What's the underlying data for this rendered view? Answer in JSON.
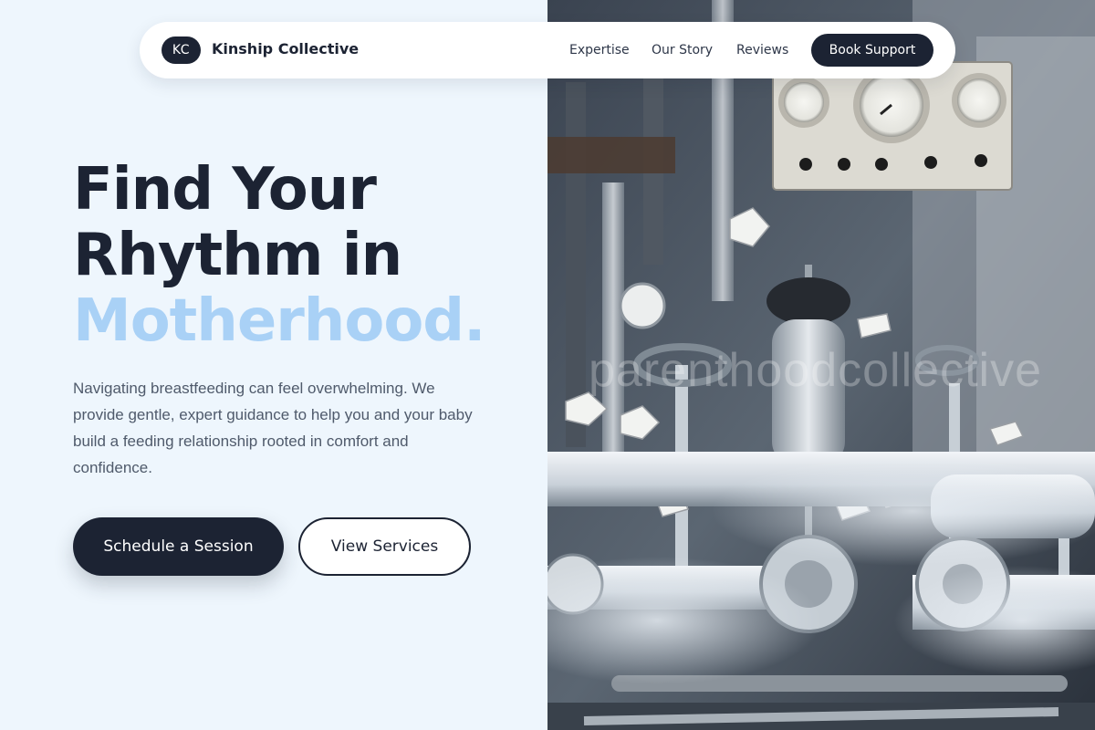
{
  "nav": {
    "brand_initials": "KC",
    "brand_name": "Kinship Collective",
    "links": [
      {
        "label": "Expertise"
      },
      {
        "label": "Our Story"
      },
      {
        "label": "Reviews"
      }
    ],
    "cta_label": "Book Support"
  },
  "hero": {
    "title_line1": "Find Your",
    "title_line2": "Rhythm in",
    "title_accent": "Motherhood.",
    "description": "Navigating breastfeeding can feel overwhelming. We provide gentle, expert guidance to help you and your baby build a feeding relationship rooted in comfort and confidence.",
    "primary_button": "Schedule a Session",
    "secondary_button": "View Services"
  },
  "image": {
    "watermark": "parenthoodcollective",
    "alt": "industrial valves and pipes"
  },
  "colors": {
    "dark": "#1c2333",
    "accent_light_blue": "#a9d1f6",
    "background": "#eef6fd"
  }
}
